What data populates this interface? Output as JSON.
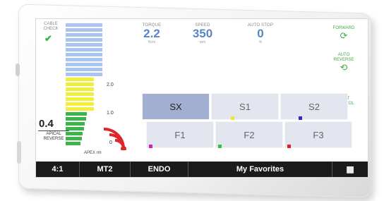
{
  "status": {
    "cable_label": "CABLE\nCHECK",
    "check_icon": "check-icon"
  },
  "gauge": {
    "scale_labels": [
      "2.0",
      "1.0",
      "0"
    ],
    "apex_label": "APEX rm",
    "value": "0.4",
    "value_label": "APICAL\nREVERSE",
    "colors": {
      "blue": "#a9c4ee",
      "yellow": "#f1ee3c",
      "green": "#3bb54a",
      "red": "#e0262b"
    }
  },
  "metrics": [
    {
      "label": "TORQUE",
      "value": "2.2",
      "unit": "Ncm"
    },
    {
      "label": "SPEED",
      "value": "350",
      "unit": "rpm"
    },
    {
      "label": "AUTO STOP",
      "value": "0",
      "unit": "%"
    }
  ],
  "controls": [
    {
      "label": "FORWARD",
      "icon": "forward-rotation-icon"
    },
    {
      "label": "AUTO\nREVERSE",
      "icon": "auto-reverse-icon"
    },
    {
      "label": "FOOT\nCONTROL",
      "icon": "foot-pedal-icon"
    }
  ],
  "programs": {
    "row1": [
      "SX",
      "S1",
      "S2"
    ],
    "row2": [
      "F1",
      "F2",
      "F3"
    ],
    "active": "SX",
    "marker_colors": [
      "#f2e530",
      "#2a2ad0",
      "#d020b8",
      "#35c04a",
      "#e02020"
    ]
  },
  "bottombar": {
    "tabs": [
      "4:1",
      "MT2",
      "ENDO",
      "My Favorites"
    ],
    "menu_icon": "grid-menu-icon"
  }
}
